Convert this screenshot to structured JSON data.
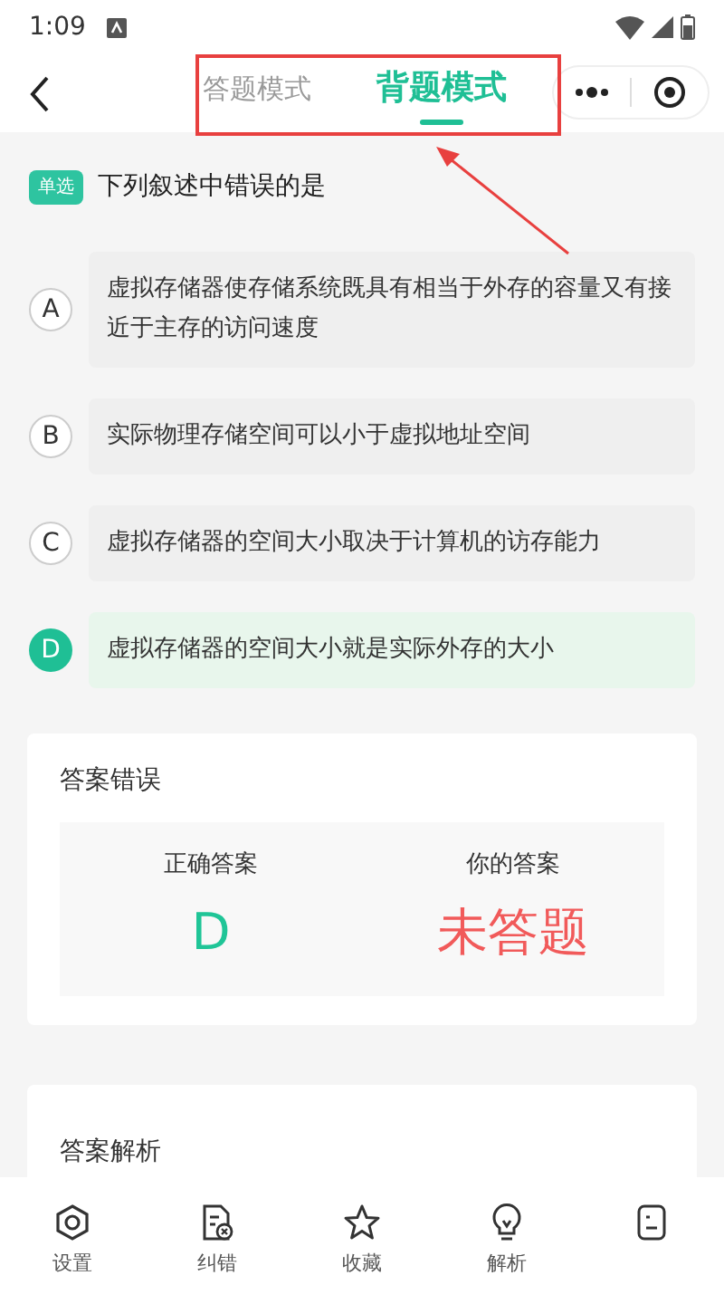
{
  "status_bar": {
    "time": "1:09"
  },
  "header": {
    "tabs": [
      {
        "label": "答题模式",
        "selected": false
      },
      {
        "label": "背题模式",
        "selected": true
      }
    ]
  },
  "question": {
    "tag": "单选",
    "text": "下列叙述中错误的是",
    "options": [
      {
        "letter": "A",
        "text": "虚拟存储器使存储系统既具有相当于外存的容量又有接近于主存的访问速度",
        "selected": false
      },
      {
        "letter": "B",
        "text": "实际物理存储空间可以小于虚拟地址空间",
        "selected": false
      },
      {
        "letter": "C",
        "text": "虚拟存储器的空间大小取决于计算机的访存能力",
        "selected": false
      },
      {
        "letter": "D",
        "text": "虚拟存储器的空间大小就是实际外存的大小",
        "selected": true
      }
    ]
  },
  "result": {
    "title": "答案错误",
    "correct_label": "正确答案",
    "correct_value": "D",
    "yours_label": "你的答案",
    "yours_value": "未答题"
  },
  "explanation": {
    "title": "答案解析"
  },
  "bottom_bar": [
    {
      "kind": "settings",
      "label": "设置"
    },
    {
      "kind": "report",
      "label": "纠错"
    },
    {
      "kind": "star",
      "label": "收藏"
    },
    {
      "kind": "bulb",
      "label": "解析"
    },
    {
      "kind": "note"
    }
  ]
}
